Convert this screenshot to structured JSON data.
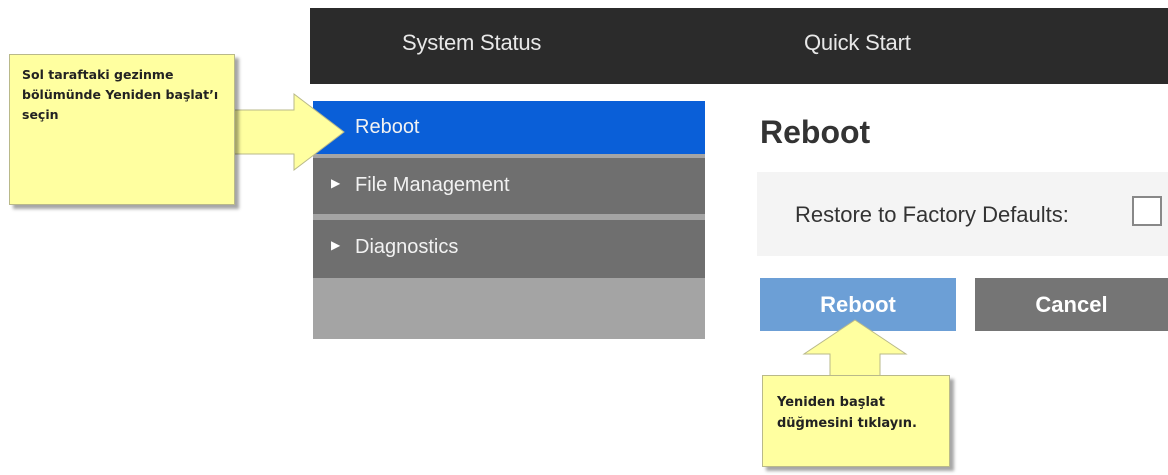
{
  "topbar": {
    "tabs": [
      "System Status",
      "Quick Start"
    ]
  },
  "sidebar": {
    "items": [
      {
        "label": "Reboot",
        "selected": true
      },
      {
        "label": "File Management",
        "expandable": true
      },
      {
        "label": "Diagnostics",
        "expandable": true
      }
    ]
  },
  "main": {
    "title": "Reboot",
    "restore_label": "Restore to Factory Defaults:",
    "restore_checked": false,
    "reboot_button": "Reboot",
    "cancel_button": "Cancel"
  },
  "callouts": {
    "left_text": "Sol taraftaki gezinme bölümünde Yeniden başlat’ı seçin",
    "bottom_text": "Yeniden başlat düğmesini tıklayın."
  },
  "colors": {
    "topbar": "#2b2b2b",
    "selected": "#0a5fd8",
    "sidebar_item": "#6f6f6f",
    "reboot_btn": "#6c9fd6",
    "cancel_btn": "#757575",
    "callout": "#ffffa0"
  },
  "icons": {
    "caret": "caret-right-icon"
  }
}
